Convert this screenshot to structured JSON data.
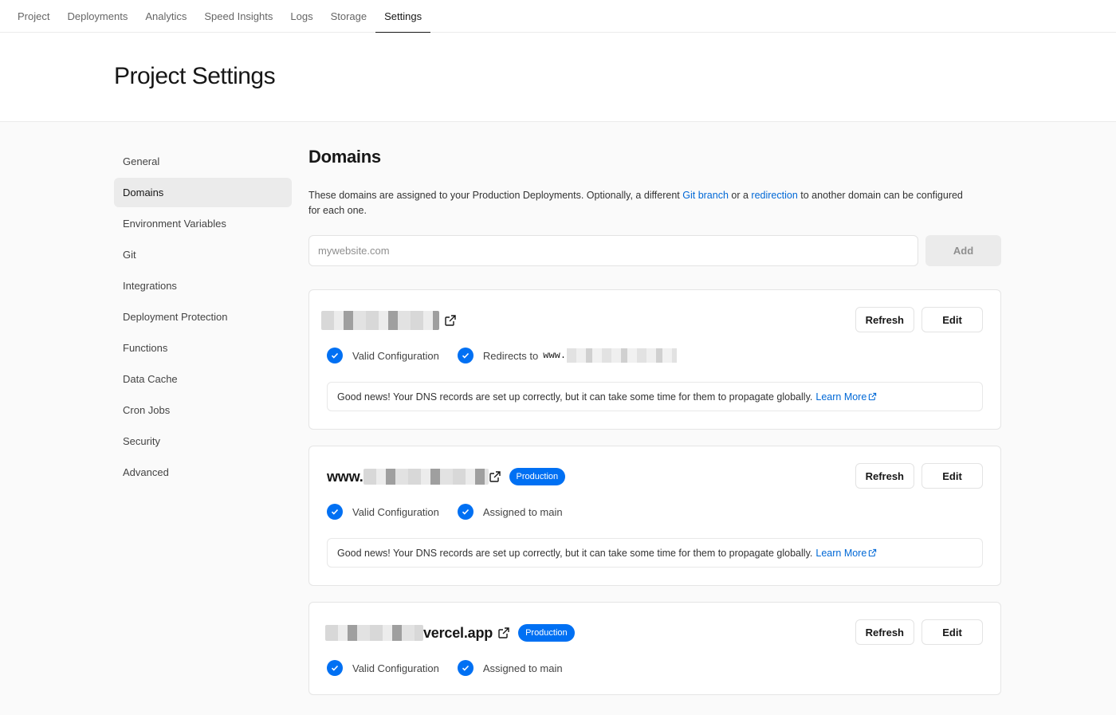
{
  "topnav": {
    "tabs": [
      {
        "label": "Project"
      },
      {
        "label": "Deployments"
      },
      {
        "label": "Analytics"
      },
      {
        "label": "Speed Insights"
      },
      {
        "label": "Logs"
      },
      {
        "label": "Storage"
      },
      {
        "label": "Settings",
        "active": true
      }
    ]
  },
  "header": {
    "title": "Project Settings"
  },
  "sidebar": {
    "items": [
      {
        "label": "General"
      },
      {
        "label": "Domains",
        "active": true
      },
      {
        "label": "Environment Variables"
      },
      {
        "label": "Git"
      },
      {
        "label": "Integrations"
      },
      {
        "label": "Deployment Protection"
      },
      {
        "label": "Functions"
      },
      {
        "label": "Data Cache"
      },
      {
        "label": "Cron Jobs"
      },
      {
        "label": "Security"
      },
      {
        "label": "Advanced"
      }
    ]
  },
  "domains": {
    "title": "Domains",
    "description_before": "These domains are assigned to your Production Deployments. Optionally, a different ",
    "link_git_branch": "Git branch",
    "description_mid": " or a ",
    "link_redirection": "redirection",
    "description_after": " to another domain can be configured for each one.",
    "input_placeholder": "mywebsite.com",
    "input_value": "",
    "add_label": "Add"
  },
  "cards": [
    {
      "domain_prefix": "",
      "domain_suffix": "",
      "badge": "",
      "refresh_label": "Refresh",
      "edit_label": "Edit",
      "status_valid": "Valid Configuration",
      "status_second": "Redirects to",
      "redirect_target_prefix": "www.",
      "note": "Good news! Your DNS records are set up correctly, but it can take some time for them to propagate globally.",
      "learn_more": "Learn More"
    },
    {
      "domain_prefix": "www.",
      "domain_suffix": "",
      "badge": "Production",
      "refresh_label": "Refresh",
      "edit_label": "Edit",
      "status_valid": "Valid Configuration",
      "status_second": "Assigned to main",
      "note": "Good news! Your DNS records are set up correctly, but it can take some time for them to propagate globally.",
      "learn_more": "Learn More"
    },
    {
      "domain_prefix": "",
      "domain_suffix": "vercel.app",
      "badge": "Production",
      "refresh_label": "Refresh",
      "edit_label": "Edit",
      "status_valid": "Valid Configuration",
      "status_second": "Assigned to main"
    }
  ],
  "colors": {
    "accent": "#0070f3",
    "link": "#0068d6"
  },
  "icons": {
    "external_link": "external-link-icon",
    "check": "check-circle-icon"
  }
}
